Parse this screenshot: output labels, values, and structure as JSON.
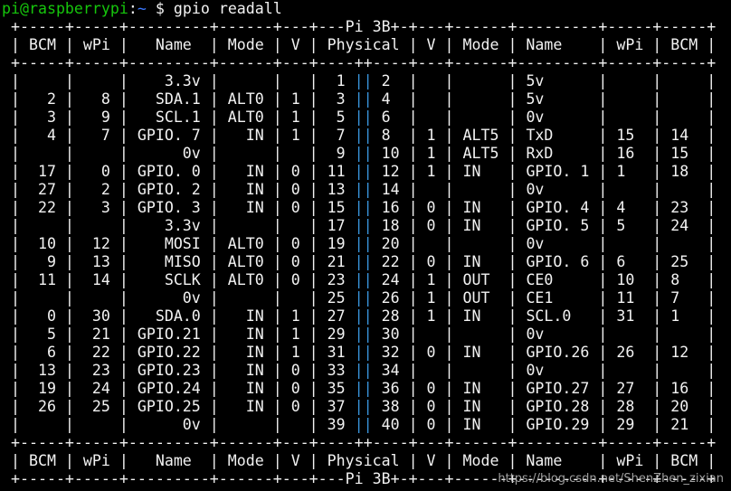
{
  "prompt": {
    "user_host": "pi@raspberrypi",
    "path": "~",
    "symbol": "$",
    "command": "gpio readall"
  },
  "colors": {
    "background": "#000000",
    "text": "#f2f2f2",
    "prompt_user": "#16c60c",
    "prompt_path": "#3b78ff",
    "physical_separator": "#3a96dd"
  },
  "table": {
    "border_top": " +-----+-----+---------+------+---+---Pi 3B+-+---+------+---------+-----+-----+",
    "border_mid": " +-----+-----+---------+------+---+----++----+---+------+---------+-----+-----+",
    "border_bottom": " +-----+-----+---------+------+---+---Pi 3B+-+---+------+---------+-----+-----+",
    "header": " | BCM | wPi |   Name  | Mode | V | Physical | V | Mode | Name    | wPi | BCM |",
    "rows": [
      {
        "left": " |     |     |    3.3v |      |   |  1 ",
        "right": " 2  |   |      | 5v      |     |     |"
      },
      {
        "left": " |   2 |   8 |   SDA.1 | ALT0 | 1 |  3 ",
        "right": " 4  |   |      | 5v      |     |     |"
      },
      {
        "left": " |   3 |   9 |   SCL.1 | ALT0 | 1 |  5 ",
        "right": " 6  |   |      | 0v      |     |     |"
      },
      {
        "left": " |   4 |   7 | GPIO. 7 |   IN | 1 |  7 ",
        "right": " 8  | 1 | ALT5 | TxD     | 15  | 14  |"
      },
      {
        "left": " |     |     |      0v |      |   |  9 ",
        "right": " 10 | 1 | ALT5 | RxD     | 16  | 15  |"
      },
      {
        "left": " |  17 |   0 | GPIO. 0 |   IN | 0 | 11 ",
        "right": " 12 | 1 | IN   | GPIO. 1 | 1   | 18  |"
      },
      {
        "left": " |  27 |   2 | GPIO. 2 |   IN | 0 | 13 ",
        "right": " 14 |   |      | 0v      |     |     |"
      },
      {
        "left": " |  22 |   3 | GPIO. 3 |   IN | 0 | 15 ",
        "right": " 16 | 0 | IN   | GPIO. 4 | 4   | 23  |"
      },
      {
        "left": " |     |     |    3.3v |      |   | 17 ",
        "right": " 18 | 0 | IN   | GPIO. 5 | 5   | 24  |"
      },
      {
        "left": " |  10 |  12 |    MOSI | ALT0 | 0 | 19 ",
        "right": " 20 |   |      | 0v      |     |     |"
      },
      {
        "left": " |   9 |  13 |    MISO | ALT0 | 0 | 21 ",
        "right": " 22 | 0 | IN   | GPIO. 6 | 6   | 25  |"
      },
      {
        "left": " |  11 |  14 |    SCLK | ALT0 | 0 | 23 ",
        "right": " 24 | 1 | OUT  | CE0     | 10  | 8   |"
      },
      {
        "left": " |     |     |      0v |      |   | 25 ",
        "right": " 26 | 1 | OUT  | CE1     | 11  | 7   |"
      },
      {
        "left": " |   0 |  30 |   SDA.0 |   IN | 1 | 27 ",
        "right": " 28 | 1 | IN   | SCL.0   | 31  | 1   |"
      },
      {
        "left": " |   5 |  21 | GPIO.21 |   IN | 1 | 29 ",
        "right": " 30 |   |      | 0v      |     |     |"
      },
      {
        "left": " |   6 |  22 | GPIO.22 |   IN | 1 | 31 ",
        "right": " 32 | 0 | IN   | GPIO.26 | 26  | 12  |"
      },
      {
        "left": " |  13 |  23 | GPIO.23 |   IN | 0 | 33 ",
        "right": " 34 |   |      | 0v      |     |     |"
      },
      {
        "left": " |  19 |  24 | GPIO.24 |   IN | 0 | 35 ",
        "right": " 36 | 0 | IN   | GPIO.27 | 27  | 16  |"
      },
      {
        "left": " |  26 |  25 | GPIO.25 |   IN | 0 | 37 ",
        "right": " 38 | 0 | IN   | GPIO.28 | 28  | 20  |"
      },
      {
        "left": " |     |     |      0v |      |   | 39 ",
        "right": " 40 | 0 | IN   | GPIO.29 | 29  | 21  |"
      }
    ],
    "separator": "||"
  },
  "watermark": "https://blog.csdn.net/ShenZhen_zixian"
}
